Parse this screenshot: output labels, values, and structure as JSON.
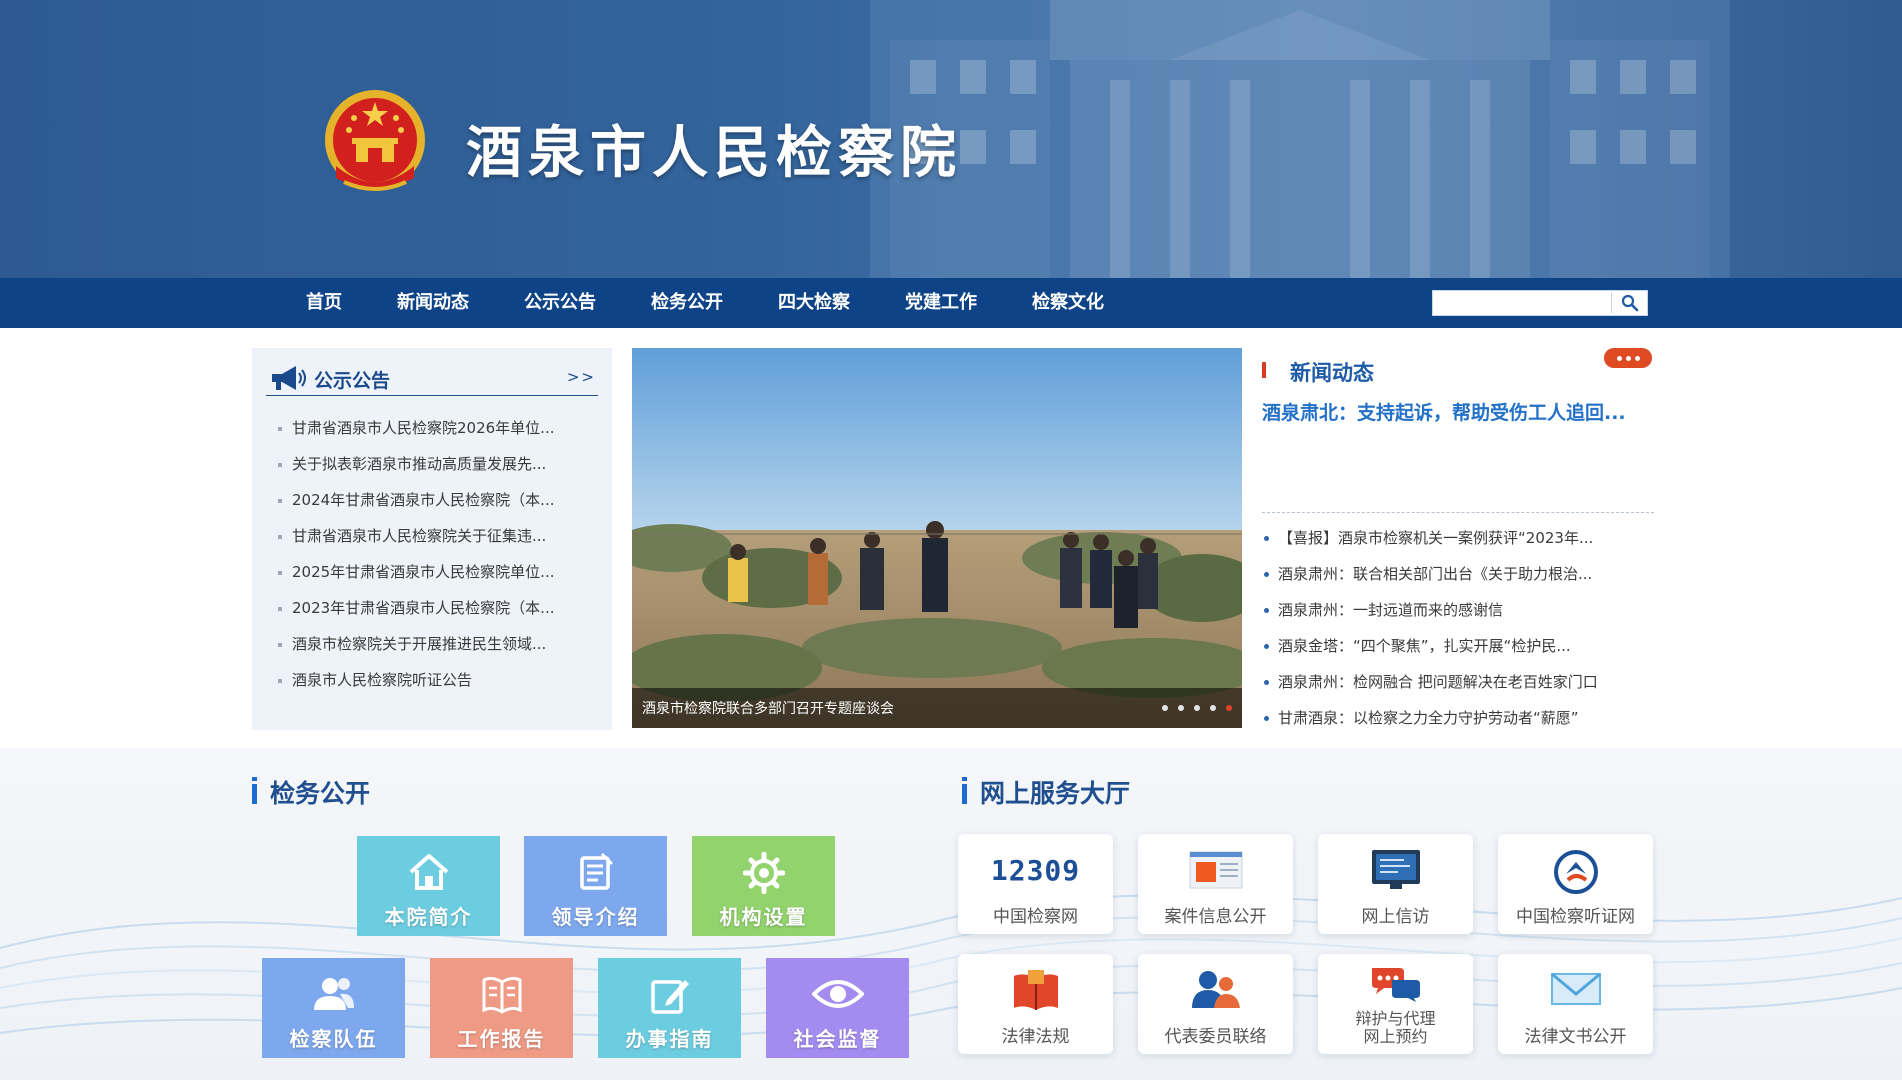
{
  "header": {
    "site_title": "酒泉市人民检察院",
    "emblem": "national-emblem"
  },
  "nav": {
    "items": [
      "首页",
      "新闻动态",
      "公示公告",
      "检务公开",
      "四大检察",
      "党建工作",
      "检察文化"
    ],
    "search_placeholder": "",
    "search_value": ""
  },
  "notice": {
    "title": "公示公告",
    "more": ">>",
    "items": [
      "甘肃省酒泉市人民检察院2026年单位...",
      "关于拟表彰酒泉市推动高质量发展先...",
      "2024年甘肃省酒泉市人民检察院（本...",
      "甘肃省酒泉市人民检察院关于征集违...",
      "2025年甘肃省酒泉市人民检察院单位...",
      "2023年甘肃省酒泉市人民检察院（本...",
      "酒泉市检察院关于开展推进民生领域...",
      "酒泉市人民检察院听证公告"
    ]
  },
  "carousel": {
    "caption": "酒泉市检察院联合多部门召开专题座谈会",
    "slide_count": 5,
    "active_slide": 5
  },
  "news": {
    "title": "新闻动态",
    "headline": "酒泉肃北：支持起诉，帮助受伤工人追回...",
    "items": [
      "【喜报】酒泉市检察机关一案例获评“2023年...",
      "酒泉肃州：联合相关部门出台《关于助力根治...",
      "酒泉肃州：一封远道而来的感谢信",
      "酒泉金塔：“四个聚焦”，扎实开展“检护民...",
      "酒泉肃州：检网融合 把问题解决在老百姓家门口",
      "甘肃酒泉：以检察之力全力守护劳动者“薪愿”"
    ]
  },
  "affairs": {
    "title": "检务公开",
    "tiles": [
      {
        "label": "本院简介",
        "icon": "home-icon"
      },
      {
        "label": "领导介绍",
        "icon": "document-icon"
      },
      {
        "label": "机构设置",
        "icon": "gear-icon"
      },
      {
        "label": "检察队伍",
        "icon": "users-icon"
      },
      {
        "label": "工作报告",
        "icon": "book-icon"
      },
      {
        "label": "办事指南",
        "icon": "edit-icon"
      },
      {
        "label": "社会监督",
        "icon": "eye-icon"
      }
    ]
  },
  "services": {
    "title": "网上服务大厅",
    "items": [
      {
        "label": "中国检察网",
        "icon": "12309-logo",
        "logo_text": "12309"
      },
      {
        "label": "案件信息公开",
        "icon": "case-info-icon"
      },
      {
        "label": "网上信访",
        "icon": "monitor-icon"
      },
      {
        "label": "中国检察听证网",
        "icon": "hearing-logo-icon"
      },
      {
        "label": "法律法规",
        "icon": "law-book-icon"
      },
      {
        "label": "代表委员联络",
        "icon": "people-icon"
      },
      {
        "label": "辩护与代理网上预约",
        "line1": "辩护与代理",
        "line2": "网上预约",
        "icon": "chat-bubbles-icon"
      },
      {
        "label": "法律文书公开",
        "icon": "envelope-icon"
      }
    ]
  },
  "colors": {
    "nav_bg": "#0e4487",
    "header_bg": "#33649c",
    "section_title": "#1f4f8f",
    "news_title": "#1e5ba6",
    "accent_red": "#e04a23",
    "tile_cyan": "#6ccde0",
    "tile_blue": "#7ea8ee",
    "tile_green": "#92d36e",
    "tile_salmon": "#ef9a85",
    "tile_purple": "#a48bf0"
  }
}
